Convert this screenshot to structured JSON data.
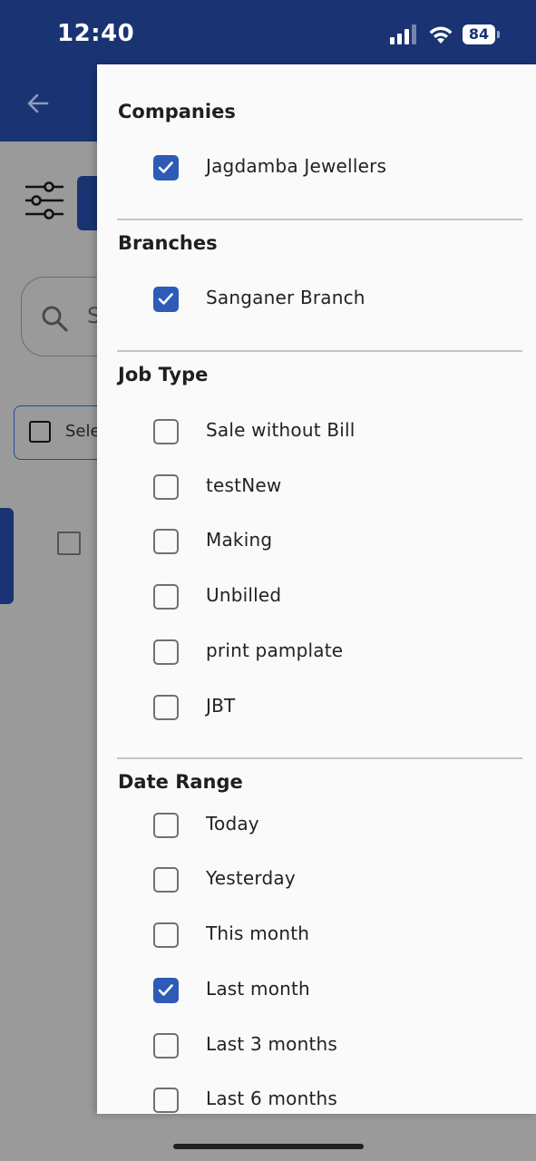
{
  "status_bar": {
    "time": "12:40",
    "battery": "84"
  },
  "background": {
    "search_placeholder_stub": "S",
    "select_stub": "Sele"
  },
  "filter_drawer": {
    "companies": {
      "title": "Companies",
      "options": [
        {
          "label": "Jagdamba Jewellers",
          "checked": true
        }
      ]
    },
    "branches": {
      "title": "Branches",
      "options": [
        {
          "label": "Sanganer Branch",
          "checked": true
        }
      ]
    },
    "job_type": {
      "title": "Job Type",
      "options": [
        {
          "label": "Sale without Bill",
          "checked": false
        },
        {
          "label": "testNew",
          "checked": false
        },
        {
          "label": "Making",
          "checked": false
        },
        {
          "label": "Unbilled",
          "checked": false
        },
        {
          "label": "print pamplate",
          "checked": false
        },
        {
          "label": "JBT",
          "checked": false
        }
      ]
    },
    "date_range": {
      "title": "Date Range",
      "options": [
        {
          "label": "Today",
          "checked": false
        },
        {
          "label": "Yesterday",
          "checked": false
        },
        {
          "label": "This month",
          "checked": false
        },
        {
          "label": "Last month",
          "checked": true
        },
        {
          "label": "Last 3 months",
          "checked": false
        },
        {
          "label": "Last 6 months",
          "checked": false
        }
      ]
    }
  },
  "colors": {
    "header": "#1a3473",
    "checkbox_checked": "#2e5bb7",
    "scrim": "#808080"
  }
}
